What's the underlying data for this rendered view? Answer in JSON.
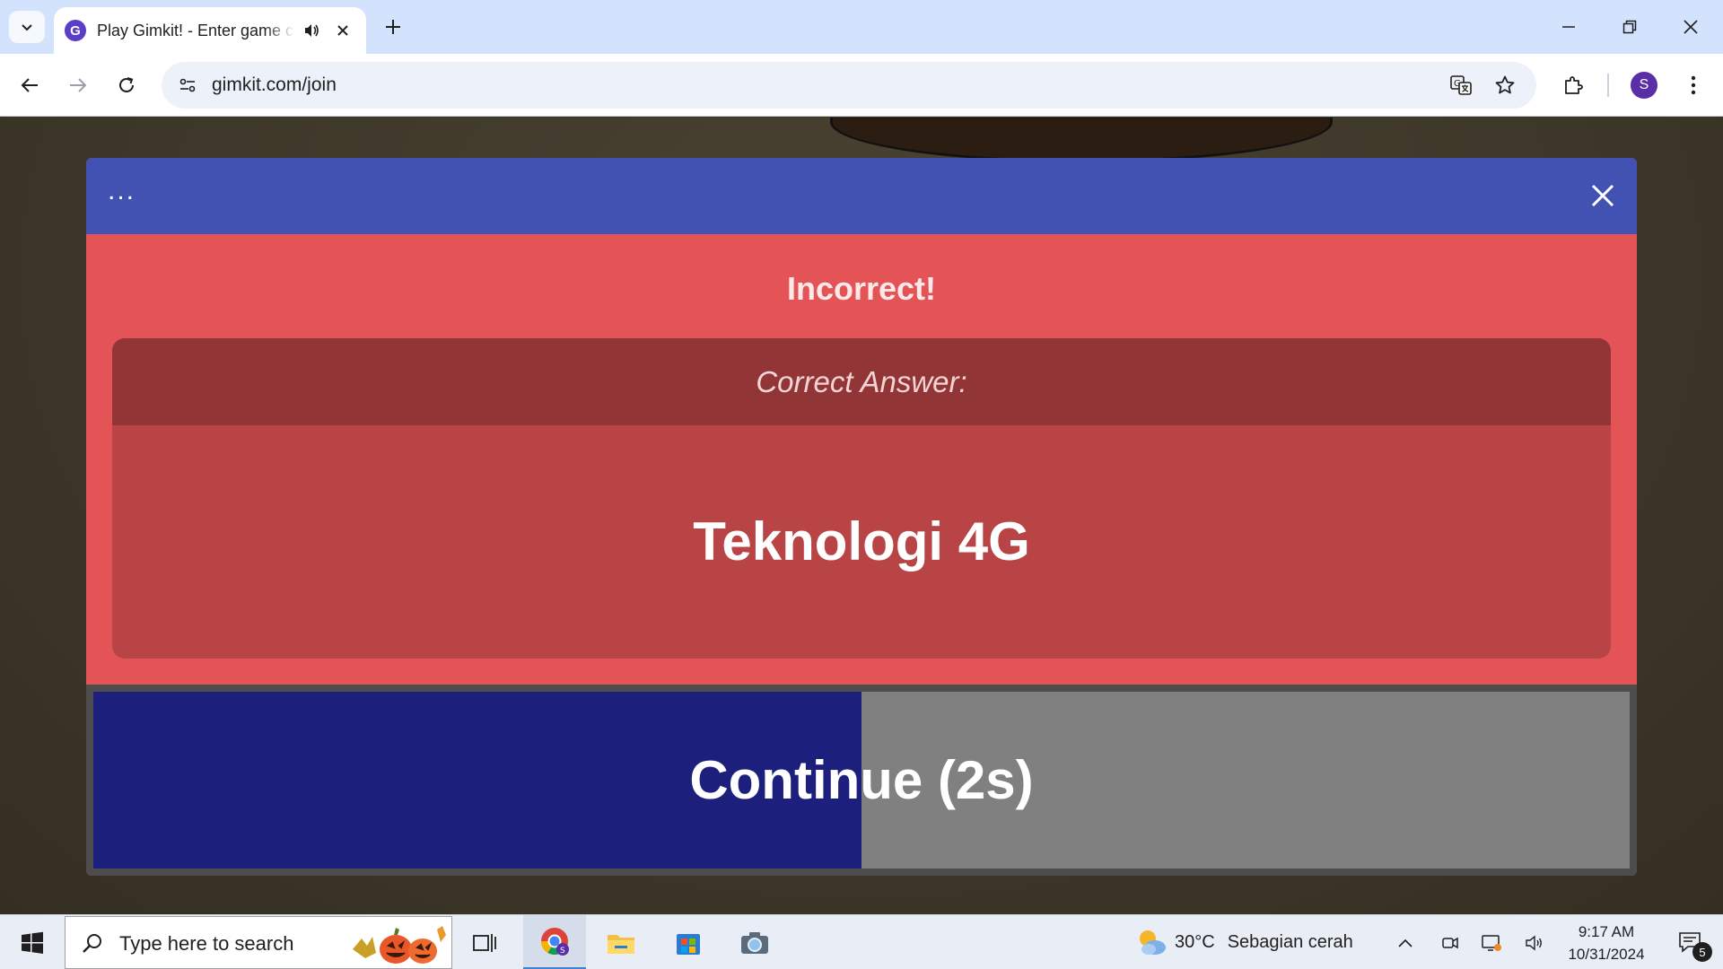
{
  "browser": {
    "tab_title": "Play Gimkit! - Enter game code",
    "url": "gimkit.com/join",
    "profile_initial": "S",
    "favicon_letter": "G"
  },
  "modal": {
    "menu_dots": "...",
    "result_title": "Incorrect!",
    "answer_label": "Correct Answer:",
    "answer_text": "Teknologi 4G",
    "continue_label": "Continue (2s)",
    "continue_progress": 0.5
  },
  "taskbar": {
    "search_placeholder": "Type here to search",
    "weather_temp": "30°C",
    "weather_desc": "Sebagian cerah",
    "time": "9:17 AM",
    "date": "10/31/2024",
    "notification_count": "5"
  },
  "colors": {
    "header": "#4152b3",
    "incorrect": "#e45456",
    "continue_fill": "#1c207c"
  }
}
